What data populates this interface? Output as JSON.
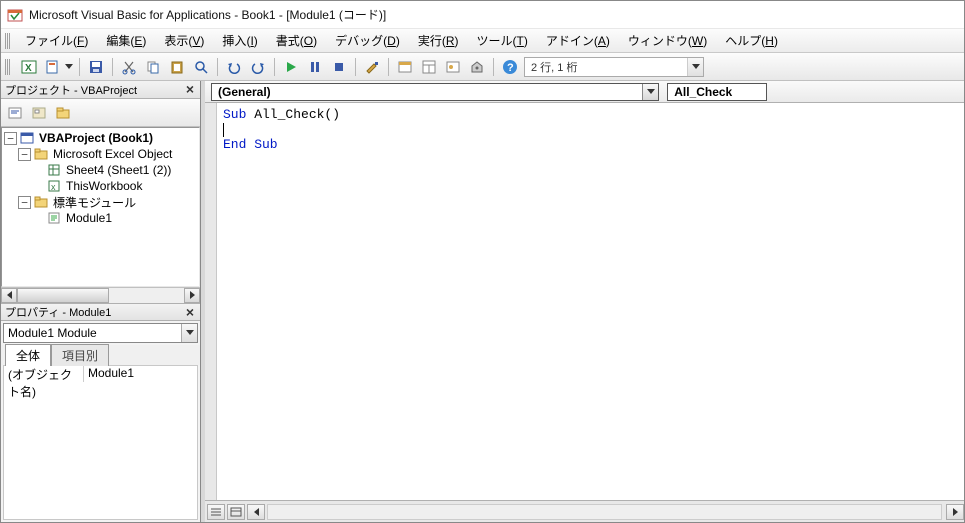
{
  "title": "Microsoft Visual Basic for Applications - Book1 - [Module1 (コード)]",
  "menu": {
    "file": {
      "label": "ファイル",
      "u": "F"
    },
    "edit": {
      "label": "編集",
      "u": "E"
    },
    "view": {
      "label": "表示",
      "u": "V"
    },
    "insert": {
      "label": "挿入",
      "u": "I"
    },
    "format": {
      "label": "書式",
      "u": "O"
    },
    "debug": {
      "label": "デバッグ",
      "u": "D"
    },
    "run": {
      "label": "実行",
      "u": "R"
    },
    "tools": {
      "label": "ツール",
      "u": "T"
    },
    "addins": {
      "label": "アドイン",
      "u": "A"
    },
    "window": {
      "label": "ウィンドウ",
      "u": "W"
    },
    "help": {
      "label": "ヘルプ",
      "u": "H"
    }
  },
  "toolbar": {
    "position": "2 行, 1 桁"
  },
  "project": {
    "pane_title": "プロジェクト - VBAProject",
    "root": "VBAProject (Book1)",
    "excel_objects": "Microsoft Excel Object",
    "sheet": "Sheet4 (Sheet1 (2))",
    "workbook": "ThisWorkbook",
    "std_modules": "標準モジュール",
    "module": "Module1"
  },
  "props": {
    "pane_title": "プロパティ - Module1",
    "combo": "Module1 Module",
    "tab_all": "全体",
    "tab_cat": "項目別",
    "row_name": "(オブジェクト名)",
    "row_val": "Module1"
  },
  "objproc": {
    "object": "(General)",
    "proc": "All_Check"
  },
  "code": {
    "line1a": "Sub",
    "line1b": " All_Check()",
    "line3": "End Sub"
  }
}
